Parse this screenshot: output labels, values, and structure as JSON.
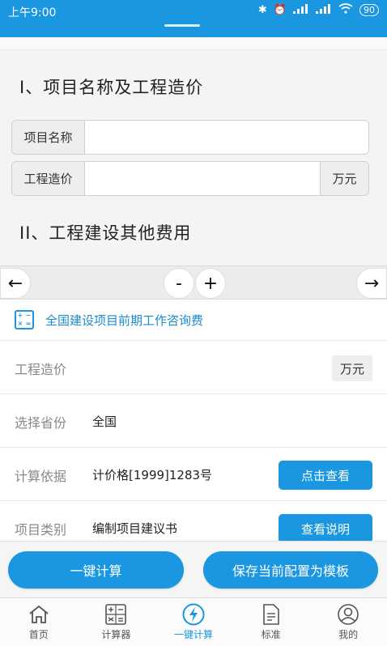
{
  "status_bar": {
    "time": "上午9:00",
    "battery": "90"
  },
  "section1": {
    "title": "I、项目名称及工程造价",
    "project_name_label": "项目名称",
    "project_name_value": "",
    "cost_label": "工程造价",
    "cost_value": "",
    "cost_unit": "万元"
  },
  "section2": {
    "title": "II、工程建设其他费用"
  },
  "toolbar": {
    "left_arrow": "←",
    "minus": "-",
    "plus": "+",
    "right_arrow": "→"
  },
  "calculator": {
    "title": "全国建设项目前期工作咨询费",
    "icon_glyphs": [
      "+",
      "−",
      "×",
      "="
    ],
    "rows": [
      {
        "label": "工程造价",
        "value": "",
        "unit": "万元"
      },
      {
        "label": "选择省份",
        "value": "全国"
      },
      {
        "label": "计算依据",
        "value": "计价格[1999]1283号",
        "button": "点击查看"
      },
      {
        "label": "项目类别",
        "value": "编制项目建议书",
        "button": "查看说明"
      }
    ]
  },
  "actions": {
    "calculate": "一键计算",
    "save_template": "保存当前配置为模板"
  },
  "tabs": [
    {
      "label": "首页",
      "icon": "home-icon"
    },
    {
      "label": "计算器",
      "icon": "calculator-icon"
    },
    {
      "label": "一键计算",
      "icon": "lightning-icon",
      "active": true
    },
    {
      "label": "标准",
      "icon": "document-icon"
    },
    {
      "label": "我的",
      "icon": "user-icon"
    }
  ],
  "colors": {
    "accent": "#1a97e0"
  }
}
